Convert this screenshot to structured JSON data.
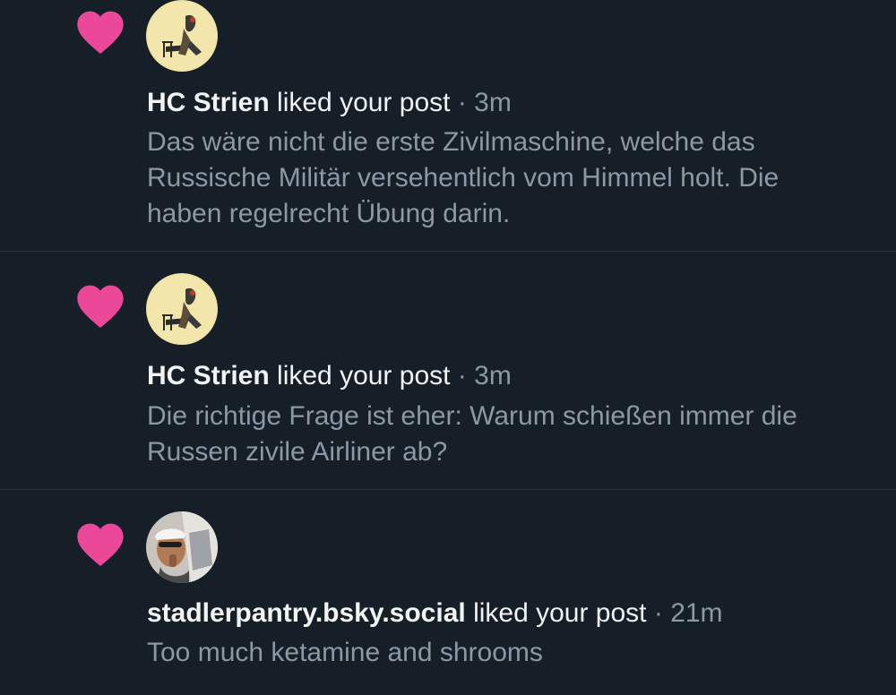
{
  "colors": {
    "background": "#161e27",
    "heart": "#ec4899",
    "primary_text": "#f1f3f5",
    "secondary_text": "#8d98a5",
    "divider": "#2a3440"
  },
  "notifications": [
    {
      "icon": "heart-icon",
      "author": "HC Strien",
      "action": "liked your post",
      "separator": "·",
      "time": "3m",
      "post_text": "Das wäre nicht die erste Zivilmaschine, welche das Russische Militär versehentlich vom Himmel holt. Die haben regelrecht Übung darin."
    },
    {
      "icon": "heart-icon",
      "author": "HC Strien",
      "action": "liked your post",
      "separator": "·",
      "time": "3m",
      "post_text": "Die richtige Frage ist eher: Warum schießen immer die Russen zivile Airliner ab?"
    },
    {
      "icon": "heart-icon",
      "author": "stadlerpantry.bsky.social",
      "action": "liked your post",
      "separator": "·",
      "time": "21m",
      "post_text": "Too much ketamine and shrooms"
    }
  ]
}
